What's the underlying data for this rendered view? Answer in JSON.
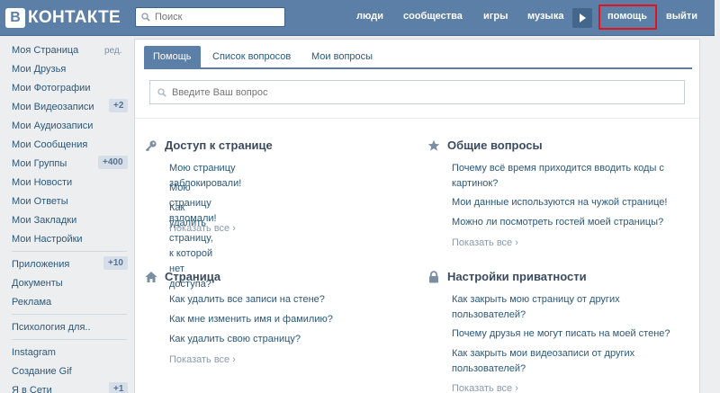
{
  "header": {
    "logo_letter": "В",
    "logo_text": "КОНТАКТЕ",
    "search_placeholder": "Поиск",
    "nav": [
      "люди",
      "сообщества",
      "игры",
      "музыка",
      "помощь",
      "выйти"
    ],
    "accent_color": "#5b7fa6",
    "highlight_color": "#e8101a"
  },
  "sidebar": {
    "items": [
      {
        "label": "Моя Страница",
        "right": "ред."
      },
      {
        "label": "Мои Друзья"
      },
      {
        "label": "Мои Фотографии"
      },
      {
        "label": "Мои Видеозаписи",
        "badge": "+2"
      },
      {
        "label": "Мои Аудиозаписи"
      },
      {
        "label": "Мои Сообщения"
      },
      {
        "label": "Мои Группы",
        "badge": "+400"
      },
      {
        "label": "Мои Новости"
      },
      {
        "label": "Мои Ответы"
      },
      {
        "label": "Мои Закладки"
      },
      {
        "label": "Мои Настройки"
      },
      {
        "label": "Приложения",
        "badge": "+10"
      },
      {
        "label": "Документы"
      },
      {
        "label": "Реклама"
      },
      {
        "label": "Психология для.."
      },
      {
        "label": "Instagram"
      },
      {
        "label": "Создание Gif"
      },
      {
        "label": "Я в Сети",
        "badge": "+1"
      }
    ]
  },
  "main": {
    "tabs": [
      "Помощь",
      "Список вопросов",
      "Мои вопросы"
    ],
    "question_placeholder": "Введите Ваш вопрос",
    "show_all": "Показать все",
    "sections": [
      {
        "icon": "key-icon",
        "title": "Доступ к странице",
        "questions": [
          "Мою страницу заблокировали!",
          "Мою страницу взломали!",
          "Как удалить страницу, к которой нет доступа?"
        ]
      },
      {
        "icon": "star-icon",
        "title": "Общие вопросы",
        "questions": [
          "Почему всё время приходится вводить коды с картинок?",
          "Мои данные используются на чужой странице!",
          "Можно ли посмотреть гостей моей страницы?"
        ]
      },
      {
        "icon": "home-icon",
        "title": "Страница",
        "questions": [
          "Как удалить все записи на стене?",
          "Как мне изменить имя и фамилию?",
          "Как удалить свою страницу?"
        ]
      },
      {
        "icon": "lock-icon",
        "title": "Настройки приватности",
        "questions": [
          "Как закрыть мою страницу от других пользователей?",
          "Почему друзья не могут писать на моей стене?",
          "Как закрыть мои видеозаписи от других пользователей?"
        ]
      }
    ]
  }
}
